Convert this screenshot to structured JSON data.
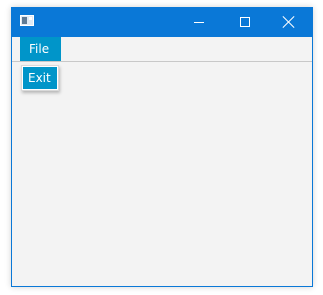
{
  "window": {
    "title": "",
    "accent_color": "#0a78d7",
    "menu_highlight_color": "#0095c9",
    "background_color": "#f3f3f3"
  },
  "titlebar": {
    "icon": "app-window-icon",
    "buttons": [
      {
        "name": "minimize",
        "icon": "minimize-icon"
      },
      {
        "name": "maximize",
        "icon": "maximize-icon"
      },
      {
        "name": "close",
        "icon": "close-icon"
      }
    ]
  },
  "menubar": {
    "items": [
      {
        "label": "File",
        "open": true
      }
    ]
  },
  "dropdown": {
    "items": [
      {
        "label": "Exit",
        "highlighted": true
      }
    ]
  }
}
